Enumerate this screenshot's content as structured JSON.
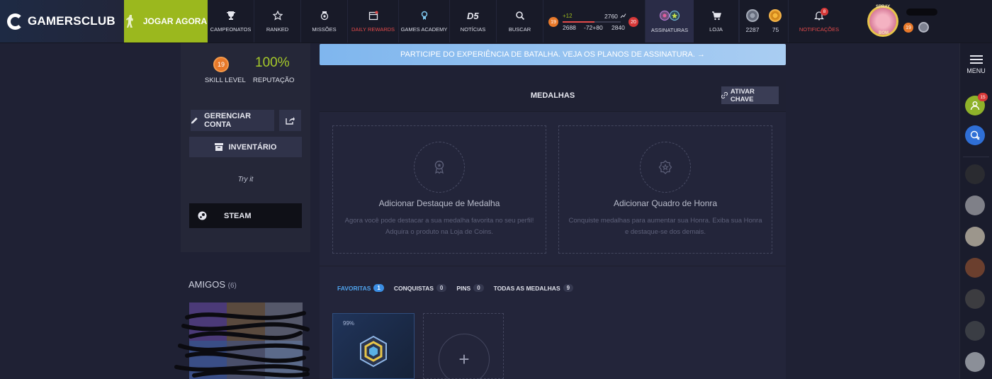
{
  "brand": {
    "name": "GAMERSCLUB"
  },
  "nav": {
    "play_label": "JOGAR AGORA",
    "items": [
      {
        "label": "CAMPEONATOS",
        "icon": "trophy-icon"
      },
      {
        "label": "RANKED",
        "icon": "star-icon"
      },
      {
        "label": "MISSÕES",
        "icon": "medal-icon"
      },
      {
        "label": "DAILY REWARDS",
        "icon": "calendar-icon"
      },
      {
        "label": "GAMES ACADEMY",
        "icon": "academy-icon"
      },
      {
        "label": "NOTÍCIAS",
        "icon": "d5-icon"
      },
      {
        "label": "BUSCAR",
        "icon": "search-icon"
      }
    ],
    "stats": {
      "level_left": "19",
      "delta": "+12",
      "elo_top": "2760",
      "level_right": "20",
      "elo_min": "2688",
      "elo_range": "-72+80",
      "elo_max": "2840"
    },
    "subscriptions_label": "ASSINATURAS",
    "store_label": "LOJA",
    "coins": {
      "silver": "2287",
      "gold": "75"
    },
    "notifications_label": "NOTIFICAÇÕES",
    "notifications_count": "8",
    "profile_level": "19",
    "profile_badge_top": "SPRAY",
    "profile_badge_bottom": "BOM"
  },
  "rightbar": {
    "menu_label": "MENU",
    "friend_requests_count": "15"
  },
  "left_panel": {
    "skill_level_value": "19",
    "skill_level_label": "SKILL LEVEL",
    "reputation_value": "100%",
    "reputation_label": "REPUTAÇÃO",
    "manage_label": "GERENCIAR CONTA",
    "inventory_label": "INVENTÁRIO",
    "try_it": "Try it",
    "steam_label": "STEAM"
  },
  "friends": {
    "title": "AMIGOS",
    "count": "(6)"
  },
  "banner": {
    "text": "PARTICIPE DO EXPERIÊNCIA DE BATALHA. VEJA OS PLANOS DE ASSINATURA. →"
  },
  "medals": {
    "title": "MEDALHAS",
    "activate_label": "ATIVAR CHAVE",
    "card_left": {
      "title": "Adicionar Destaque de Medalha",
      "desc": "Agora você pode destacar a sua medalha favorita no seu perfil! Adquira o produto na Loja de Coins."
    },
    "card_right": {
      "title": "Adicionar Quadro de Honra",
      "desc": "Conquiste medalhas para aumentar sua Honra. Exiba sua Honra e destaque-se dos demais."
    },
    "tabs": [
      {
        "label": "FAVORITAS",
        "count": "1"
      },
      {
        "label": "CONQUISTAS",
        "count": "0"
      },
      {
        "label": "PINS",
        "count": "0"
      },
      {
        "label": "TODAS AS MEDALHAS",
        "count": "9"
      }
    ],
    "favorite_percent": "99%"
  },
  "colors": {
    "accent_green": "#9bb81e",
    "accent_blue": "#3b8ee4",
    "level_orange": "#e8792a",
    "level_red": "#d63838"
  }
}
